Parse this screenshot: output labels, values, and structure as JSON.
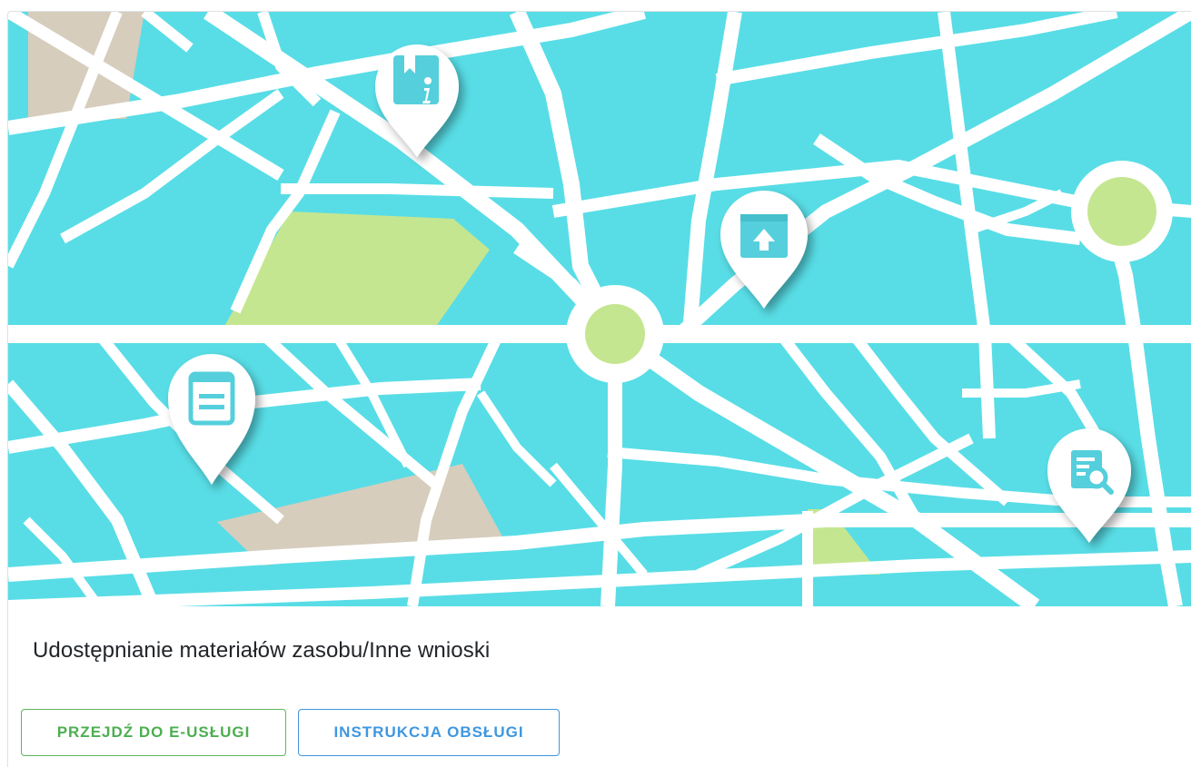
{
  "card": {
    "image": {
      "name": "city-map-illustration",
      "colors": {
        "water": "#58dde6",
        "road": "#ffffff",
        "park": "#c5e690",
        "block": "#d6cdbd",
        "pin_icon": "#55cfdc"
      },
      "pins": [
        {
          "icon": "document-info-icon"
        },
        {
          "icon": "archive-upload-icon"
        },
        {
          "icon": "form-list-icon"
        },
        {
          "icon": "search-document-icon"
        }
      ]
    },
    "title": "Udostępnianie materiałów zasobu/Inne wnioski",
    "actions": {
      "go_label": "PRZEJDŹ DO E-USŁUGI",
      "manual_label": "INSTRUKCJA OBSŁUGI"
    },
    "colors": {
      "go": "#4caf50",
      "manual": "#3f97e0"
    }
  }
}
